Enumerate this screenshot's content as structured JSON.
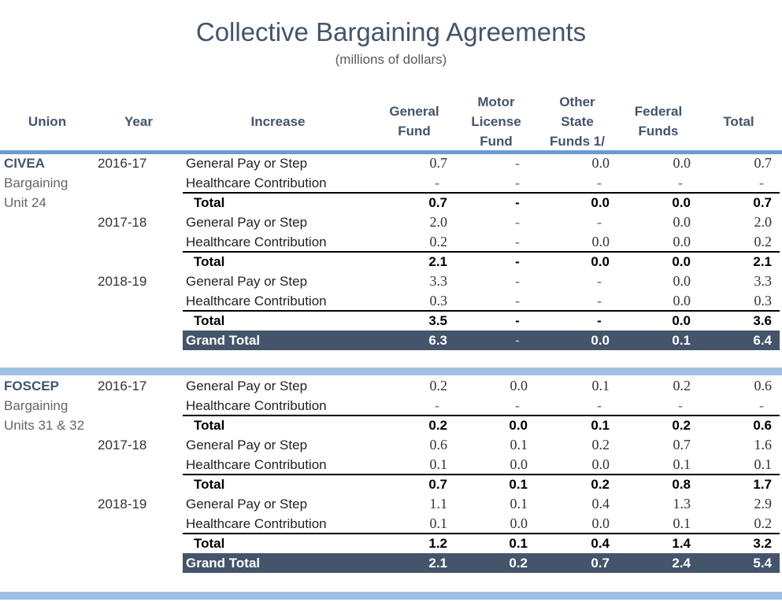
{
  "title": "Collective Bargaining Agreements",
  "subtitle": "(millions of dollars)",
  "headers": {
    "union": "Union",
    "year": "Year",
    "increase": "Increase",
    "general_fund": [
      "General",
      "Fund"
    ],
    "motor_license_fund": [
      "Motor",
      "License",
      "Fund"
    ],
    "other_state_funds": [
      "Other",
      "State",
      "Funds 1/"
    ],
    "federal_funds": [
      "Federal",
      "Funds"
    ],
    "total": "Total"
  },
  "colors": {
    "header_text": "#44546a",
    "top_rule": "#6a9bd1",
    "band": "#a0c0e3",
    "grand_total_bg": "#44546a"
  },
  "unions": [
    {
      "name": "CIVEA",
      "sub": [
        "Bargaining",
        "Unit 24"
      ],
      "years": [
        {
          "year": "2016-17",
          "rows": [
            {
              "label": "General Pay or Step",
              "values": [
                "0.7",
                "-",
                "0.0",
                "0.0",
                "0.7"
              ]
            },
            {
              "label": "Healthcare Contribution",
              "values": [
                "-",
                "-",
                "-",
                "-",
                "-"
              ]
            },
            {
              "label": "Total",
              "values": [
                "0.7",
                "-",
                "0.0",
                "0.0",
                "0.7"
              ]
            }
          ]
        },
        {
          "year": "2017-18",
          "rows": [
            {
              "label": "General Pay or Step",
              "values": [
                "2.0",
                "-",
                "-",
                "0.0",
                "2.0"
              ]
            },
            {
              "label": "Healthcare Contribution",
              "values": [
                "0.2",
                "-",
                "0.0",
                "0.0",
                "0.2"
              ]
            },
            {
              "label": "Total",
              "values": [
                "2.1",
                "-",
                "0.0",
                "0.0",
                "2.1"
              ]
            }
          ]
        },
        {
          "year": "2018-19",
          "rows": [
            {
              "label": "General Pay or Step",
              "values": [
                "3.3",
                "-",
                "-",
                "0.0",
                "3.3"
              ]
            },
            {
              "label": "Healthcare Contribution",
              "values": [
                "0.3",
                "-",
                "-",
                "0.0",
                "0.3"
              ]
            },
            {
              "label": "Total",
              "values": [
                "3.5",
                "-",
                "-",
                "0.0",
                "3.6"
              ]
            }
          ]
        }
      ],
      "grand_total": {
        "label": "Grand Total",
        "values": [
          "6.3",
          "-",
          "0.0",
          "0.1",
          "6.4"
        ]
      }
    },
    {
      "name": "FOSCEP",
      "sub": [
        "Bargaining",
        "Units 31 & 32"
      ],
      "years": [
        {
          "year": "2016-17",
          "rows": [
            {
              "label": "General Pay or Step",
              "values": [
                "0.2",
                "0.0",
                "0.1",
                "0.2",
                "0.6"
              ]
            },
            {
              "label": "Healthcare Contribution",
              "values": [
                "-",
                "-",
                "-",
                "-",
                "-"
              ]
            },
            {
              "label": "Total",
              "values": [
                "0.2",
                "0.0",
                "0.1",
                "0.2",
                "0.6"
              ]
            }
          ]
        },
        {
          "year": "2017-18",
          "rows": [
            {
              "label": "General Pay or Step",
              "values": [
                "0.6",
                "0.1",
                "0.2",
                "0.7",
                "1.6"
              ]
            },
            {
              "label": "Healthcare Contribution",
              "values": [
                "0.1",
                "0.0",
                "0.0",
                "0.1",
                "0.1"
              ]
            },
            {
              "label": "Total",
              "values": [
                "0.7",
                "0.1",
                "0.2",
                "0.8",
                "1.7"
              ]
            }
          ]
        },
        {
          "year": "2018-19",
          "rows": [
            {
              "label": "General Pay or Step",
              "values": [
                "1.1",
                "0.1",
                "0.4",
                "1.3",
                "2.9"
              ]
            },
            {
              "label": "Healthcare Contribution",
              "values": [
                "0.1",
                "0.0",
                "0.0",
                "0.1",
                "0.2"
              ]
            },
            {
              "label": "Total",
              "values": [
                "1.2",
                "0.1",
                "0.4",
                "1.4",
                "3.2"
              ]
            }
          ]
        }
      ],
      "grand_total": {
        "label": "Grand Total",
        "values": [
          "2.1",
          "0.2",
          "0.7",
          "2.4",
          "5.4"
        ]
      }
    }
  ]
}
